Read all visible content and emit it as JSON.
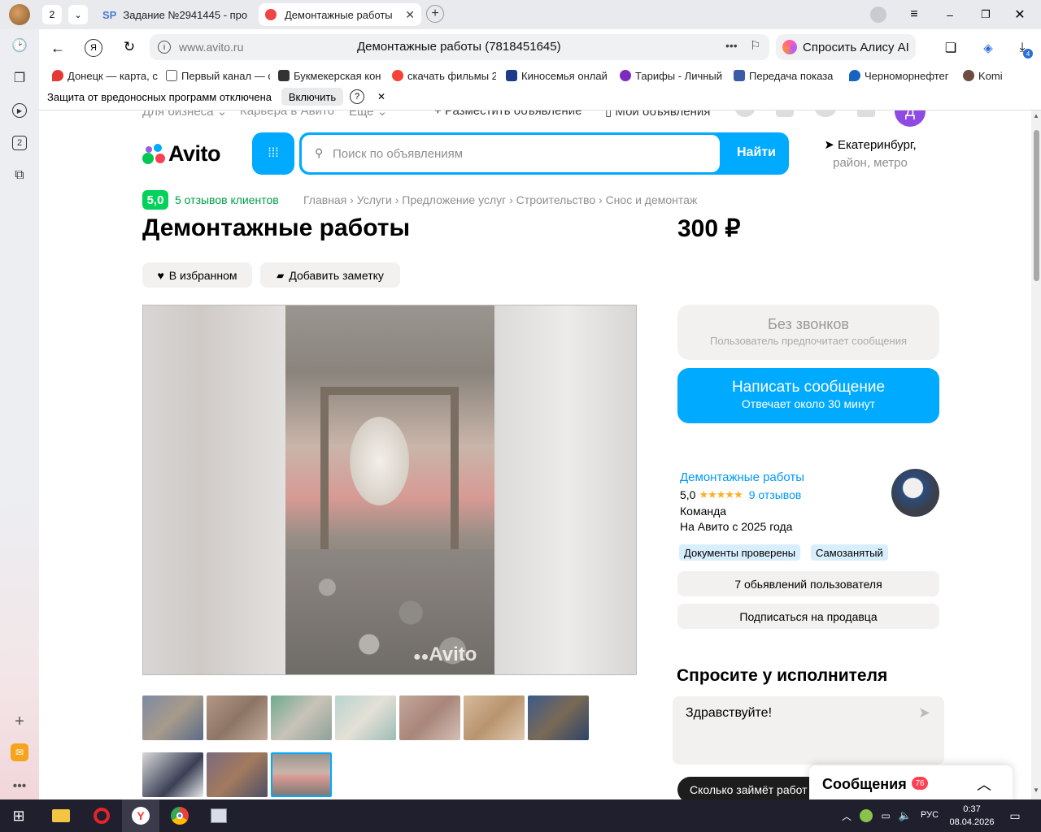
{
  "browser": {
    "tab_count": "2",
    "tabs": [
      {
        "label": "Задание №2941445 - про"
      },
      {
        "label": "Демонтажные работы"
      }
    ],
    "address": "www.avito.ru",
    "page_title": "Демонтажные работы (7818451645)",
    "alice_label": "Спросить Алису AI",
    "downloads_badge": "4",
    "side_counter": "2",
    "bookmarks": [
      {
        "label": "Донецк — карта, с",
        "color": "#e53935"
      },
      {
        "label": "Первый канал — с",
        "color": "#444"
      },
      {
        "label": "Букмекерская кон",
        "color": "#333"
      },
      {
        "label": "скачать фильмы 2",
        "color": "#f44336"
      },
      {
        "label": "Киносемья онлай",
        "color": "#1e3a8a"
      },
      {
        "label": "Тарифы - Личный",
        "color": "#7b2cbf"
      },
      {
        "label": "Передача показа",
        "color": "#3b5ba8"
      },
      {
        "label": "Черноморнефтег",
        "color": "#1565c0"
      },
      {
        "label": "Komi",
        "color": "#6d4c41"
      }
    ],
    "protection_text": "Защита от вредоносных программ отключена",
    "protection_button": "Включить",
    "protection_help": "?"
  },
  "avito": {
    "top_links": [
      "Для бизнеса",
      "Карьера в Авито",
      "Еще"
    ],
    "post_ad": "Разместить объявление",
    "my_ads": "Мои объявления",
    "avatar_letter": "Д",
    "logo": "Avito",
    "search_placeholder": "Поиск по объявлениям",
    "search_button": "Найти",
    "city": "Екатеринбург,",
    "city_sub": "район, метро",
    "rating_badge": "5,0",
    "reviews_link": "5 отзывов клиентов",
    "breadcrumbs": [
      "Главная",
      "Услуги",
      "Предложение услуг",
      "Строительство",
      "Снос и демонтаж"
    ],
    "title": "Демонтажные работы",
    "price": "300 ₽",
    "favorite_btn": "В избранном",
    "note_btn": "Добавить заметку",
    "watermark": "Avito",
    "no_calls": "Без звонков",
    "no_calls_sub": "Пользователь предпочитает сообщения",
    "write_msg": "Написать сообщение",
    "write_msg_sub": "Отвечает около 30 минут",
    "seller_name": "Демонтажные работы",
    "seller_rating": "5,0",
    "seller_stars": "★★★★★",
    "seller_reviews": "9 отзывов",
    "seller_type": "Команда",
    "seller_since": "На Авито с 2025 года",
    "chip_docs": "Документы проверены",
    "chip_self": "Самозанятый",
    "user_ads": "7 обьявлений пользователя",
    "subscribe": "Подписаться на продавца",
    "ask_title": "Спросите у исполнителя",
    "ask_text": "Здравствуйте!",
    "quick_q": "Сколько займёт работ",
    "messages_label": "Сообщения",
    "messages_badge": "76"
  },
  "taskbar": {
    "lang": "РУС",
    "time": "0:37",
    "date": "08.04.2026"
  }
}
